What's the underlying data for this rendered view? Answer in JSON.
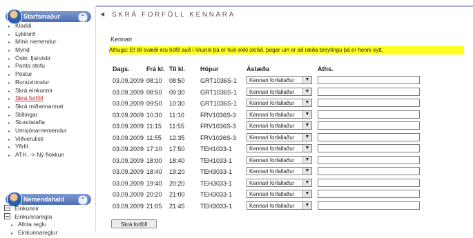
{
  "sidebar": {
    "panel1_title": "Starfsmaður",
    "panel1_items": [
      {
        "label": "Kladdi"
      },
      {
        "label": "Lykilorð"
      },
      {
        "label": "Mínir nemendur"
      },
      {
        "label": "Mynd"
      },
      {
        "label": "Óskr. fjarvistir"
      },
      {
        "label": "Panta stofu"
      },
      {
        "label": "Póstur"
      },
      {
        "label": "Runuvinnslur"
      },
      {
        "label": "Skrá einkunnir"
      },
      {
        "label": "Skrá forföll",
        "active": true
      },
      {
        "label": "Skrá miðannarmat"
      },
      {
        "label": "Stillingar"
      },
      {
        "label": "Stundatafla"
      },
      {
        "label": "Umsjónarnemendur"
      },
      {
        "label": "Viðverulisti"
      },
      {
        "label": "Yfirlit"
      },
      {
        "label": "ATH. -> Ný flokkun"
      }
    ],
    "panel2_title": "Nemendahald",
    "panel2_items": [
      {
        "label": "Einkunnir",
        "type": "group"
      },
      {
        "label": "Einkunnaregla",
        "type": "group"
      },
      {
        "label": "Afrita reglu",
        "type": "item"
      },
      {
        "label": "Einkunnareglur",
        "type": "item"
      }
    ]
  },
  "page": {
    "title": "SKRÁ FORFÖLL KENNARA",
    "section": "Kennari",
    "warning": "Athuga: Ef öll svæði eru höfð auð í línunni þá er hún ekki skráð, þegar um er að ræða breytingu þá er henni eytt."
  },
  "table": {
    "headers": {
      "date": "Dags.",
      "from": "Frá kl.",
      "to": "Til kl.",
      "group": "Hópur",
      "reason": "Ástæða",
      "notes": "Aths."
    },
    "rows": [
      {
        "date": "03.09.2009",
        "from": "08:10",
        "to": "08:50",
        "group": "GRT1036S-1",
        "reason": "Kennari forfallaður",
        "notes": ""
      },
      {
        "date": "03.09.2009",
        "from": "08:50",
        "to": "09:30",
        "group": "GRT1036S-1",
        "reason": "Kennari forfallaður",
        "notes": ""
      },
      {
        "date": "03.09.2009",
        "from": "09:50",
        "to": "10:30",
        "group": "GRT1036S-1",
        "reason": "Kennari forfallaður",
        "notes": ""
      },
      {
        "date": "03.09.2009",
        "from": "10:30",
        "to": "11:10",
        "group": "FRV1036S-3",
        "reason": "Kennari forfallaður",
        "notes": ""
      },
      {
        "date": "03.09.2009",
        "from": "11:15",
        "to": "11:55",
        "group": "FRV1036S-3",
        "reason": "Kennari forfallaður",
        "notes": ""
      },
      {
        "date": "03.09.2009",
        "from": "11:55",
        "to": "12:35",
        "group": "FRV1036S-3",
        "reason": "Kennari forfallaður",
        "notes": ""
      },
      {
        "date": "03.09.2009",
        "from": "17:10",
        "to": "17:50",
        "group": "TEH1033-1",
        "reason": "Kennari forfallaður",
        "notes": ""
      },
      {
        "date": "03.09.2009",
        "from": "18:00",
        "to": "18:40",
        "group": "TEH1033-1",
        "reason": "Kennari forfallaður",
        "notes": ""
      },
      {
        "date": "03.09.2009",
        "from": "18:40",
        "to": "19:20",
        "group": "TEH3033-1",
        "reason": "Kennari forfallaður",
        "notes": ""
      },
      {
        "date": "03.09.2009",
        "from": "19:40",
        "to": "20:20",
        "group": "TEH3033-1",
        "reason": "Kennari forfallaður",
        "notes": ""
      },
      {
        "date": "03.09.2009",
        "from": "20:20",
        "to": "21:00",
        "group": "TEH3033-1",
        "reason": "Kennari forfallaður",
        "notes": ""
      },
      {
        "date": "03.09.2009",
        "from": "21:05",
        "to": "21:45",
        "group": "TEH3033-1",
        "reason": "Kennari forfallaður",
        "notes": ""
      }
    ]
  },
  "submit_label": "Skrá forföll",
  "icons": {
    "collapse": "collapse-arrow-icon",
    "bullet": "bullet-icon",
    "chevron": "chevron-up-icon"
  },
  "colors": {
    "warning_bg": "#ffff22",
    "panel_header": "#4c6db4",
    "active_link": "#c8262c"
  }
}
